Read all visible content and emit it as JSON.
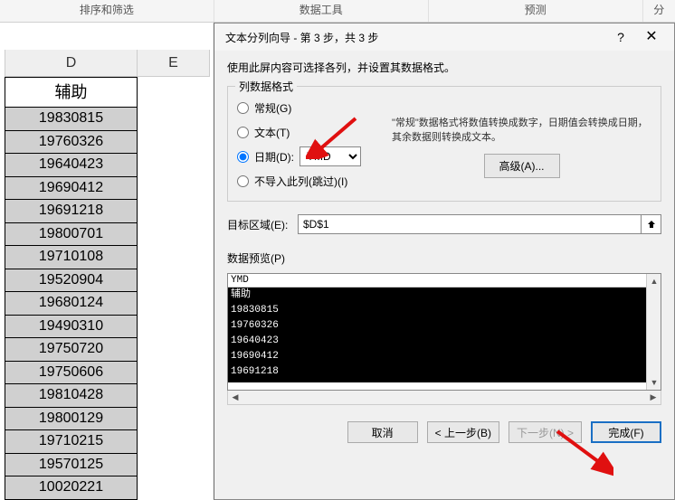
{
  "ribbon": {
    "groups": [
      "排序和筛选",
      "数据工具",
      "预测",
      "分"
    ]
  },
  "spreadsheet": {
    "col_d": "D",
    "col_e": "E",
    "header": "辅助",
    "rows": [
      "19830815",
      "19760326",
      "19640423",
      "19690412",
      "19691218",
      "19800701",
      "19710108",
      "19520904",
      "19680124",
      "19490310",
      "19750720",
      "19750606",
      "19810428",
      "19800129",
      "19710215",
      "19570125",
      "10020221"
    ]
  },
  "dialog": {
    "title": "文本分列向导 - 第 3 步，共 3 步",
    "help_tip": "?",
    "instruction": "使用此屏内容可选择各列，并设置其数据格式。",
    "format_legend": "列数据格式",
    "radio": {
      "general": "常规(G)",
      "text": "文本(T)",
      "date": "日期(D):",
      "skip": "不导入此列(跳过)(I)"
    },
    "date_format": "YMD",
    "desc": "\"常规\"数据格式将数值转换成数字，日期值会转换成日期，其余数据则转换成文本。",
    "advanced": "高级(A)...",
    "target_label": "目标区域(E):",
    "target_value": "$D$1",
    "preview_label": "数据预览(P)",
    "preview_header": "YMD",
    "preview_lines": [
      "辅助",
      "19830815",
      "19760326",
      "19640423",
      "19690412",
      "19691218"
    ],
    "buttons": {
      "cancel": "取消",
      "back": "< 上一步(B)",
      "next": "下一步(N) >",
      "finish": "完成(F)"
    }
  }
}
